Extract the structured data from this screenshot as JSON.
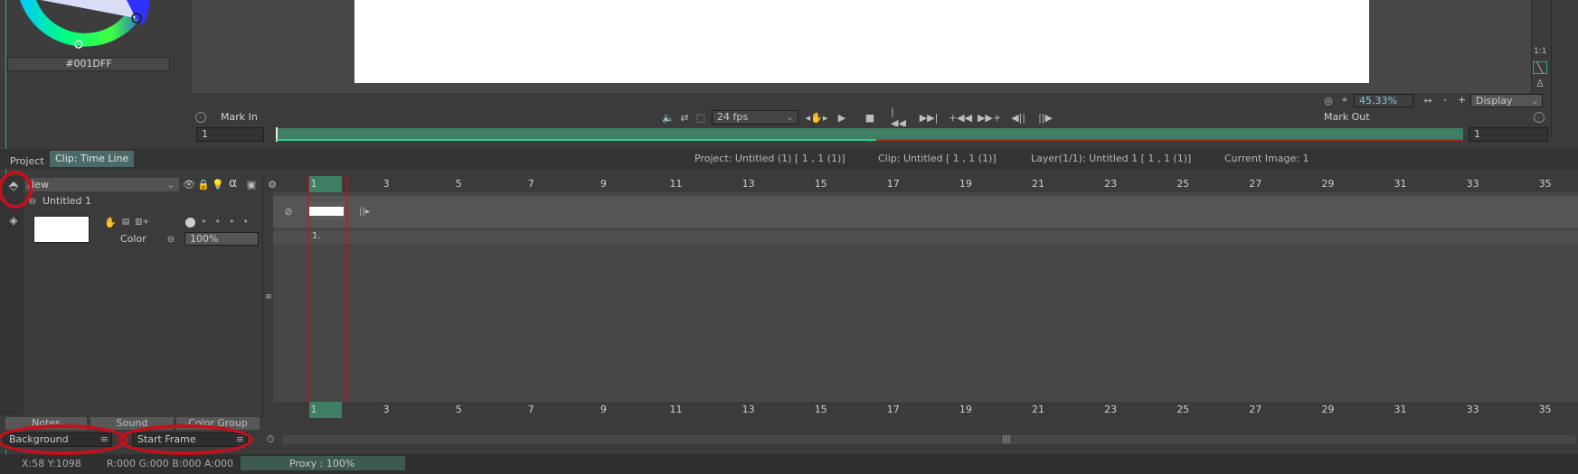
{
  "colors": {
    "panel_bg": "#3b3b3b",
    "dark_bg": "#2f2f2f",
    "timeline_bg": "#474747",
    "accent_green": "#3e7f63",
    "teal": "#5fa89a",
    "highlight_red": "#c4101c",
    "current_color": "#001DFF"
  },
  "color_wheel": {
    "hex": "#001DFF"
  },
  "viewer": {
    "zoom": "45.33%",
    "display_label": "Display",
    "zoom_minus": "-",
    "zoom_plus": "+",
    "side_labels": [
      "1:1"
    ]
  },
  "transport": {
    "mark_in_label": "Mark In",
    "mark_out_label": "Mark Out",
    "fps": "24 fps",
    "start_frame": "1",
    "end_frame": "1"
  },
  "tabs": {
    "project": "Project",
    "clip": "Clip: Time Line"
  },
  "info_bar": {
    "project": "Project: Untitled (1) [ 1 , 1  (1)]",
    "clip": "Clip: Untitled [ 1 , 1  (1)]",
    "layer": "Layer(1/1): Untitled 1 [ 1 , 1  (1)]",
    "current_image": "Current Image: 1"
  },
  "layer_panel": {
    "folder_name": "New",
    "layer_name": "Untitled 1",
    "color_label": "Color",
    "opacity": "100%",
    "alpha_symbol": "α"
  },
  "frame_ruler": {
    "ticks": [
      "1",
      "3",
      "5",
      "7",
      "9",
      "11",
      "13",
      "15",
      "17",
      "19",
      "21",
      "23",
      "25",
      "27",
      "29",
      "31",
      "33",
      "35"
    ]
  },
  "cell": {
    "frame_label": "1."
  },
  "bottom_tabs": {
    "notes": "Notes",
    "sound": "Sound",
    "color_group": "Color Group"
  },
  "bottom_fields": {
    "background": "Background",
    "start_frame": "Start Frame"
  },
  "status_bar": {
    "coords": "X:58  Y:1098",
    "rgba": "R:000 G:000 B:000 A:000",
    "proxy": "Proxy : 100%"
  }
}
